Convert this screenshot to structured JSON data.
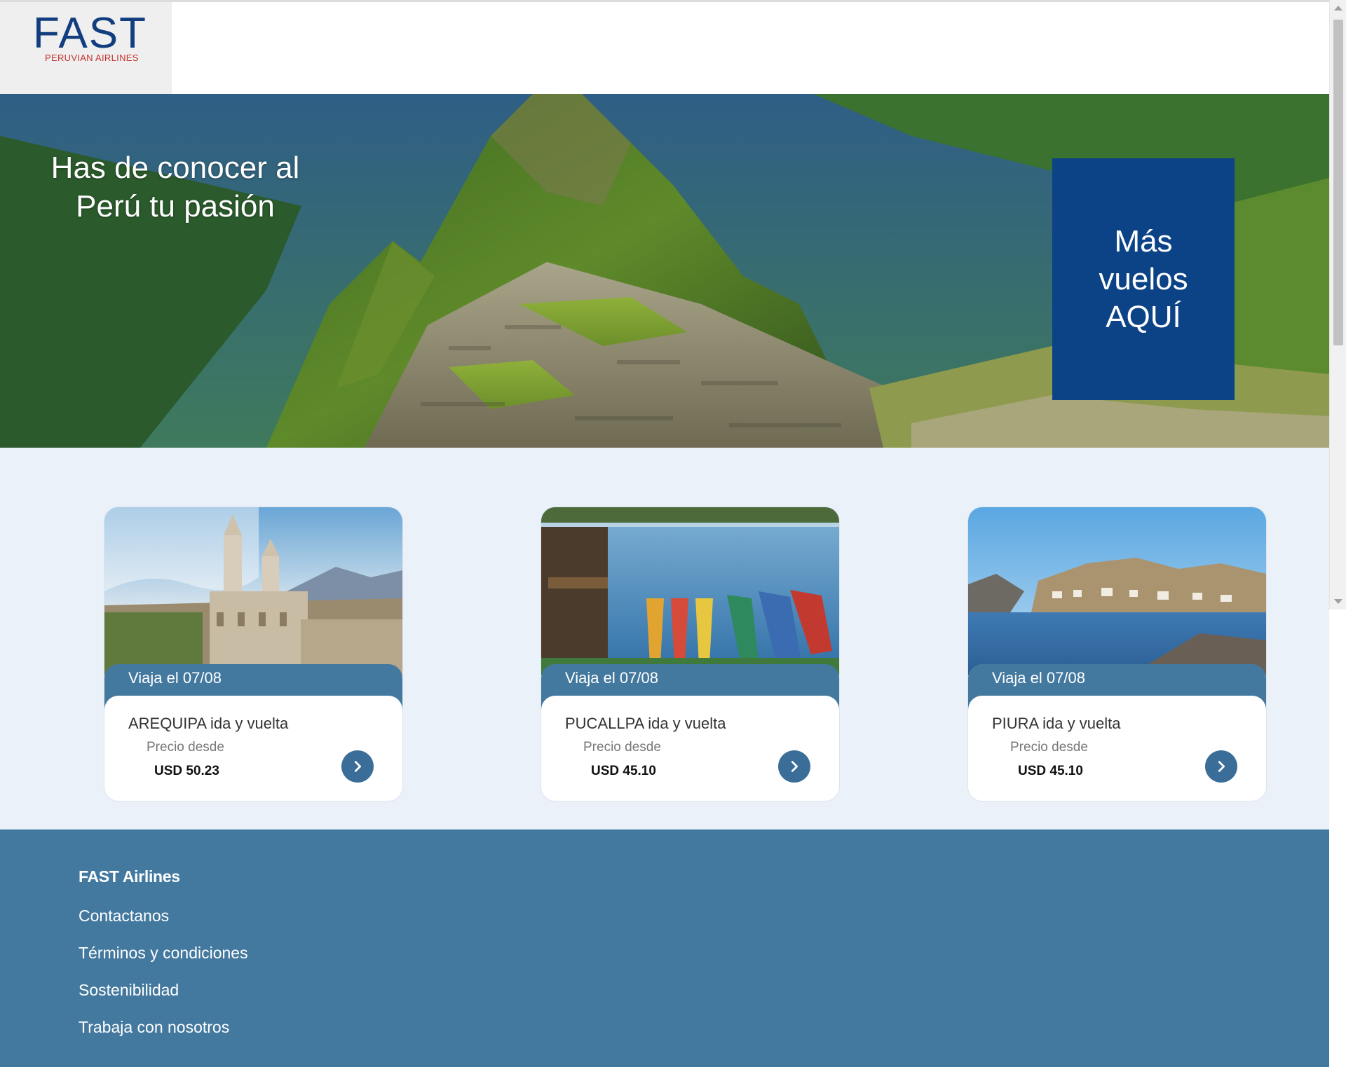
{
  "brand": {
    "logo_main": "FAST",
    "logo_sub": "PERUVIAN AIRLINES",
    "primary_color": "#0c4286",
    "accent_color": "#44799f",
    "logo_red": "#c4342f"
  },
  "hero": {
    "title": "Has de conocer al Perú tu pasión",
    "cta_label": "Más vuelos AQUÍ"
  },
  "offers": [
    {
      "date_label": "Viaja el 07/08",
      "route": "AREQUIPA ida y vuelta",
      "price_label": "Precio desde",
      "price": "USD 50.23",
      "photo": "arequipa-cathedral"
    },
    {
      "date_label": "Viaja el 07/08",
      "route": "PUCALLPA ida y vuelta",
      "price_label": "Precio desde",
      "price": "USD 45.10",
      "photo": "pucallpa-lake-boats"
    },
    {
      "date_label": "Viaja el 07/08",
      "route": "PIURA ida y vuelta",
      "price_label": "Precio desde",
      "price": "USD 45.10",
      "photo": "piura-beach"
    }
  ],
  "footer": {
    "title": "FAST Airlines",
    "links": [
      "Contactanos",
      "Términos y condiciones",
      "Sostenibilidad",
      "Trabaja con nosotros"
    ]
  },
  "icons": {
    "card_arrow": "chevron-right-icon"
  }
}
